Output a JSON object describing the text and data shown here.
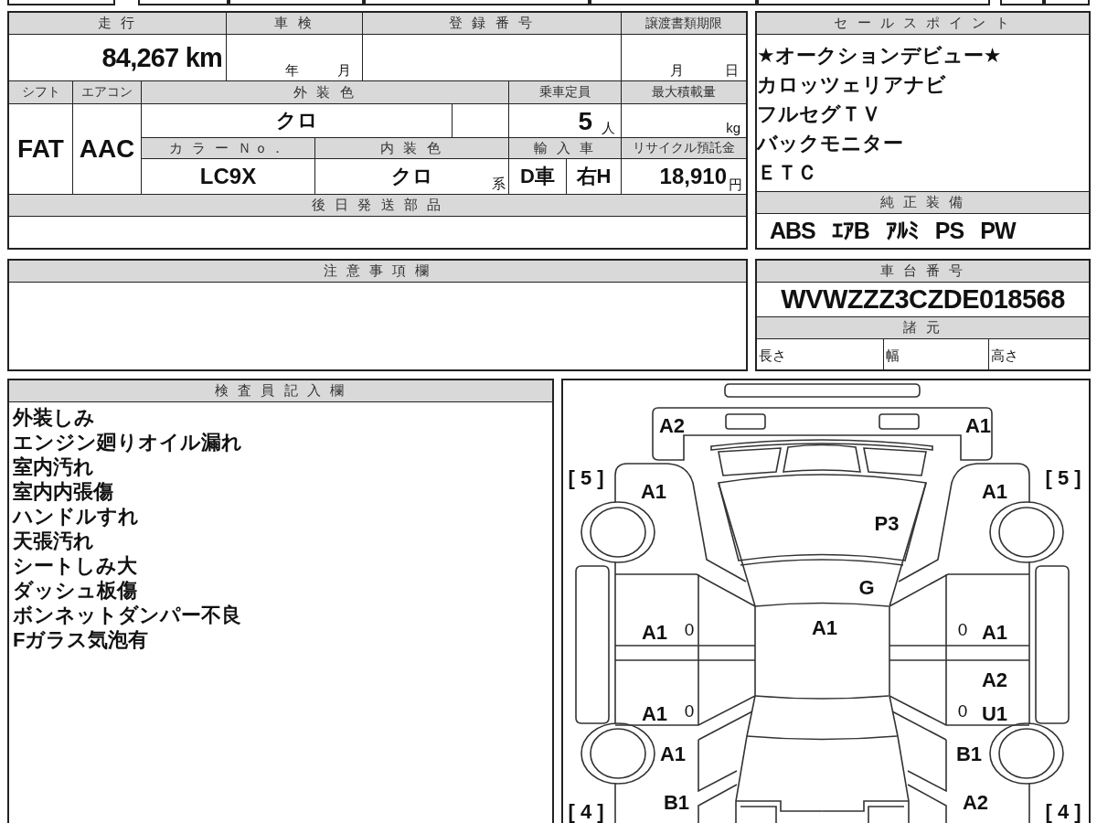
{
  "vehicle_info": {
    "mileage": {
      "label": "走 行",
      "value": "84,267 km"
    },
    "inspection": {
      "label": "車 検",
      "year_unit": "年",
      "month_unit": "月"
    },
    "registration_number": {
      "label": "登 録 番 号"
    },
    "transfer_deadline": {
      "label": "譲渡書類期限",
      "month_unit": "月",
      "day_unit": "日"
    },
    "shift": {
      "label": "シフト",
      "value": "FAT"
    },
    "air_conditioner": {
      "label": "エアコン",
      "value": "AAC"
    },
    "exterior_color": {
      "label": "外 装 色",
      "value": "クロ"
    },
    "seating_capacity": {
      "label": "乗車定員",
      "value": "5",
      "unit": "人"
    },
    "max_load": {
      "label": "最大積載量",
      "unit": "kg"
    },
    "color_number": {
      "label": "カ ラ ー Ｎｏ．",
      "value": "LC9X"
    },
    "interior_color": {
      "label": "内 装 色",
      "value": "クロ",
      "unit": "系"
    },
    "import": {
      "label": "輸 入 車",
      "values": [
        "D車",
        "右H"
      ]
    },
    "recycling_deposit": {
      "label": "リサイクル預託金",
      "value": "18,910",
      "unit": "円"
    },
    "later_shipped_parts": {
      "label": "後 日 発 送 部 品"
    }
  },
  "sales_points": {
    "label": "セ ー ル ス ポ イ ン ト",
    "items": [
      "★オークションデビュー★",
      "カロッツェリアナビ",
      "フルセグＴＶ",
      "バックモニター",
      "ＥＴＣ"
    ]
  },
  "genuine_equipment": {
    "label": "純 正 装 備",
    "items": [
      "ABS",
      "ｴｱB",
      "ｱﾙﾐ",
      "PS",
      "PW"
    ]
  },
  "caution_notes": {
    "label": "注 意 事 項 欄"
  },
  "chassis_number": {
    "label": "車 台 番 号",
    "value": "WVWZZZ3CZDE018568"
  },
  "specifications": {
    "label": "諸 元",
    "fields": [
      "長さ",
      "幅",
      "高さ"
    ]
  },
  "inspector_notes": {
    "label": "検 査 員 記 入 欄",
    "lines": [
      "外装しみ",
      "エンジン廻りオイル漏れ",
      "室内汚れ",
      "室内内張傷",
      "ハンドルすれ",
      "天張汚れ",
      "シートしみ大",
      "ダッシュ板傷",
      "ボンネットダンパー不良",
      "Fガラス気泡有"
    ]
  },
  "damage_diagram": {
    "marks": {
      "front_bumper_left": "A2",
      "front_bumper_right": "A1",
      "front_fender_left": "A1",
      "front_fender_right": "A1",
      "hood": "P3",
      "windshield": "G",
      "front_door_left": "A1",
      "front_door_left_edge": "0",
      "roof": "A1",
      "front_door_right_edge": "0",
      "front_door_right": "A1",
      "rear_door_right_upper": "A2",
      "rear_door_left": "A1",
      "rear_door_left_edge": "0",
      "rear_door_right_edge": "0",
      "rear_door_right": "U1",
      "rear_fender_left": "A1",
      "rear_fender_right": "B1",
      "rear_bumper_left": "B1",
      "rear_bumper_right": "A2"
    },
    "wheel_marks": {
      "front_left": "[ 5 ]",
      "front_right": "[ 5 ]",
      "rear_left": "[ 4 ]",
      "rear_right": "[ 4 ]"
    }
  }
}
